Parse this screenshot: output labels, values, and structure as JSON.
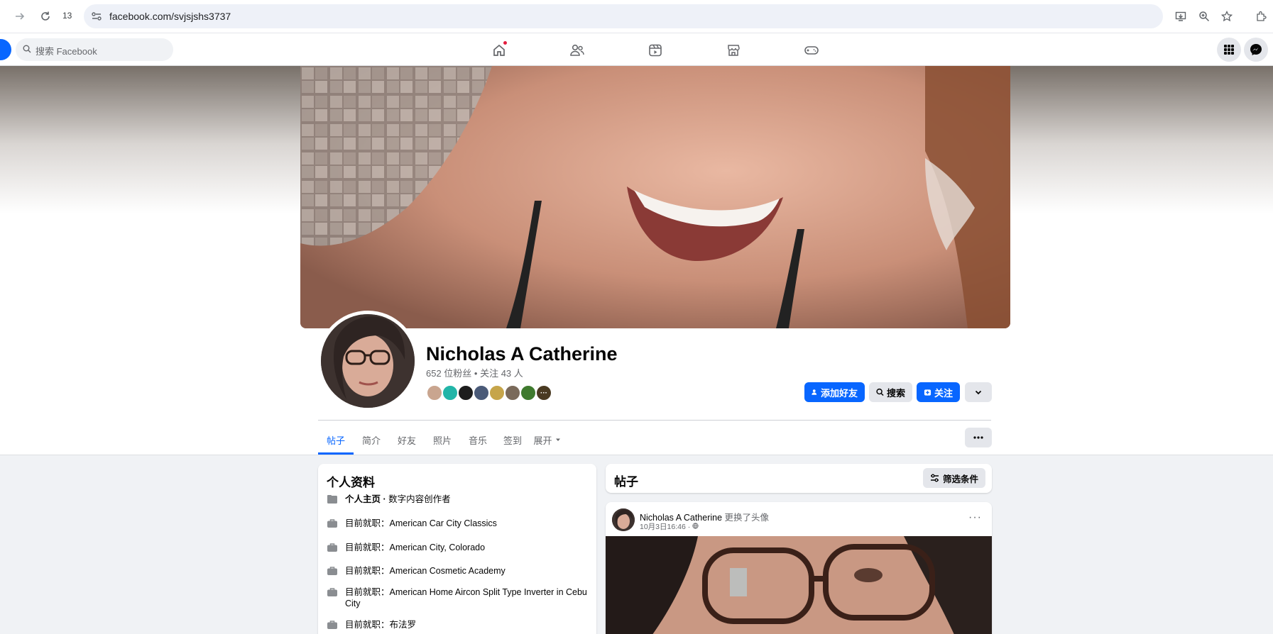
{
  "browser": {
    "tab_count": "13",
    "url": "facebook.com/svjsjshs3737"
  },
  "fb": {
    "search_placeholder": "搜索 Facebook"
  },
  "profile": {
    "name": "Nicholas A Catherine",
    "followers_line": "652 位粉丝 • 关注 43 人",
    "friend_faces_more": "···",
    "actions": {
      "add_friend": "添加好友",
      "search": "搜索",
      "follow": "关注"
    }
  },
  "tabs": [
    "帖子",
    "简介",
    "好友",
    "照片",
    "音乐",
    "签到",
    "展开"
  ],
  "intro": {
    "title": "个人资料",
    "rows": [
      {
        "prefix": "个人主页 · ",
        "value": "数字内容创作者"
      },
      {
        "prefix": "目前就职：",
        "value": "American Car City Classics"
      },
      {
        "prefix": "目前就职：",
        "value": "American City, Colorado"
      },
      {
        "prefix": "目前就职：",
        "value": "American Cosmetic Academy"
      },
      {
        "prefix": "目前就职：",
        "value": "American Home Aircon Split Type Inverter in Cebu City"
      },
      {
        "prefix": "目前就职：",
        "value": "布法罗"
      }
    ]
  },
  "posts": {
    "title": "帖子",
    "filter_label": "筛选条件",
    "first_post": {
      "author": "Nicholas A Catherine",
      "action": " 更换了头像",
      "timestamp": "10月3日16:46 · ",
      "more": "···"
    }
  },
  "colors": {
    "fb_blue": "#0866ff",
    "background": "#f0f2f5",
    "notification_red": "#e41e3f"
  },
  "icons": {
    "browser": [
      "forward-icon",
      "reload-icon",
      "site-info-icon",
      "install-app-icon",
      "zoom-icon",
      "bookmark-star-icon",
      "extension-icon"
    ],
    "fb_nav": [
      "home-icon",
      "friends-icon",
      "video-icon",
      "marketplace-icon",
      "gaming-icon"
    ],
    "fb_right": [
      "menu-grid-icon",
      "messenger-icon"
    ]
  }
}
